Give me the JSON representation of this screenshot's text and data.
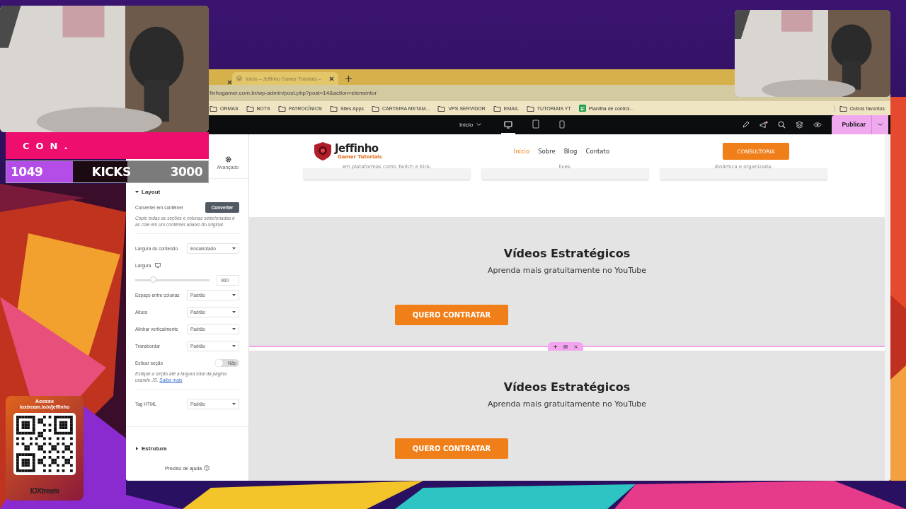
{
  "stream_overlay": {
    "banner": "CON.",
    "counter": {
      "current": "1049",
      "label": "KICKS",
      "goal": "3000",
      "level": 0.33
    }
  },
  "qr_card": {
    "heading": "Acesse",
    "url": "ioxtream.io/x/jeffinho",
    "brand": "IOXtream"
  },
  "browser": {
    "tab": {
      "title": "Início – Jeffinho Gamer Tutoriais –",
      "selected": true
    },
    "address": "finhogamer.com.br/wp-admin/post.php?post=14&action=elementor",
    "bookmarks": [
      {
        "label": "ORMAS",
        "kind": "folder"
      },
      {
        "label": "BOTS",
        "kind": "folder"
      },
      {
        "label": "PATROCÍNIOS",
        "kind": "folder"
      },
      {
        "label": "Sites Apps",
        "kind": "folder"
      },
      {
        "label": "CARTEIRA METAM...",
        "kind": "folder"
      },
      {
        "label": "VPS SERVIDOR",
        "kind": "folder"
      },
      {
        "label": "EMAIL",
        "kind": "folder"
      },
      {
        "label": "TUTORIAIS YT",
        "kind": "folder"
      },
      {
        "label": "Planilha de control...",
        "kind": "sheet"
      }
    ],
    "other_bookmarks": "Outros favoritos"
  },
  "editor_bar": {
    "page": "Início",
    "devices": [
      {
        "kind": "desktop",
        "selected": true
      },
      {
        "kind": "tablet",
        "selected": false
      },
      {
        "kind": "mobile",
        "selected": false
      }
    ],
    "publish": "Publicar"
  },
  "panel": {
    "tab": {
      "label": "Avançado",
      "selected": false
    },
    "layout_section": {
      "title": "Layout",
      "expanded": true
    },
    "controls": [
      {
        "kind": "button",
        "label": "Converter em contêiner",
        "button": "Converter"
      },
      {
        "kind": "note",
        "text": "Copie todas as seções e colunas selecionadas e as cole em um contêiner abaixo do original."
      },
      {
        "kind": "select",
        "label": "Largura do conteúdo",
        "value": "Encaixotado"
      },
      {
        "kind": "slider",
        "label": "Largura",
        "level": 0.24,
        "value": "900"
      },
      {
        "kind": "select",
        "label": "Espaço entre colunas",
        "value": "Padrão"
      },
      {
        "kind": "select",
        "label": "Altura",
        "value": "Padrão"
      },
      {
        "kind": "select",
        "label": "Alinhar verticalmente",
        "value": "Padrão"
      },
      {
        "kind": "select",
        "label": "Transbordar",
        "value": "Padrão"
      },
      {
        "kind": "toggle",
        "label": "Esticar seção",
        "on": false,
        "state_text": "Não"
      },
      {
        "kind": "note",
        "text": "Estique a seção até a largura total da página usando JS.",
        "link": "Saiba mais"
      },
      {
        "kind": "select",
        "label": "Tag HTML",
        "value": "Padrão"
      }
    ],
    "structure_section": {
      "title": "Estrutura",
      "expanded": false
    },
    "help": "Preciso de ajuda"
  },
  "site": {
    "logo_title": "Jeffinho",
    "logo_subtitle": "Gamer Tutoriais",
    "nav": [
      {
        "label": "Início",
        "selected": true
      },
      {
        "label": "Sobre",
        "selected": false
      },
      {
        "label": "Blog",
        "selected": false
      },
      {
        "label": "Contato",
        "selected": false
      }
    ],
    "cta": "CONSULTORIA",
    "card_texts": [
      "em plataformas como Twitch e Kick.",
      "lives.",
      "dinâmica e organizada."
    ],
    "sections": [
      {
        "title": "Vídeos Estratégicos",
        "subtitle": "Aprenda mais gratuitamente no YouTube",
        "button": "QUERO CONTRATAR",
        "selected": true
      },
      {
        "title": "Vídeos Estratégicos",
        "subtitle": "Aprenda mais gratuitamente no YouTube",
        "button": "QUERO CONTRATAR",
        "selected": false
      }
    ]
  }
}
